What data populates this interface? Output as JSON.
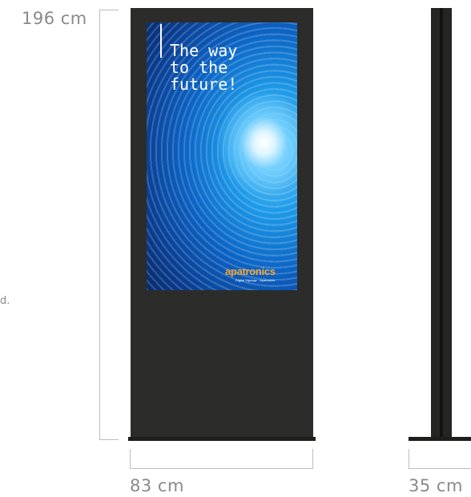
{
  "dimensions": {
    "height": "196 cm",
    "front_width": "83 cm",
    "side_depth": "35 cm"
  },
  "screen": {
    "headline": "The way\nto the\nfuture!",
    "logo": "apatronics",
    "logo_tagline": "Digital Signage · Apatronics"
  },
  "stray_text": "d.",
  "colors": {
    "kiosk": "#2c2c2a",
    "dimension_text": "#8a8a8a",
    "dimension_line": "#bdbdbd",
    "logo": "#f2a83a"
  }
}
